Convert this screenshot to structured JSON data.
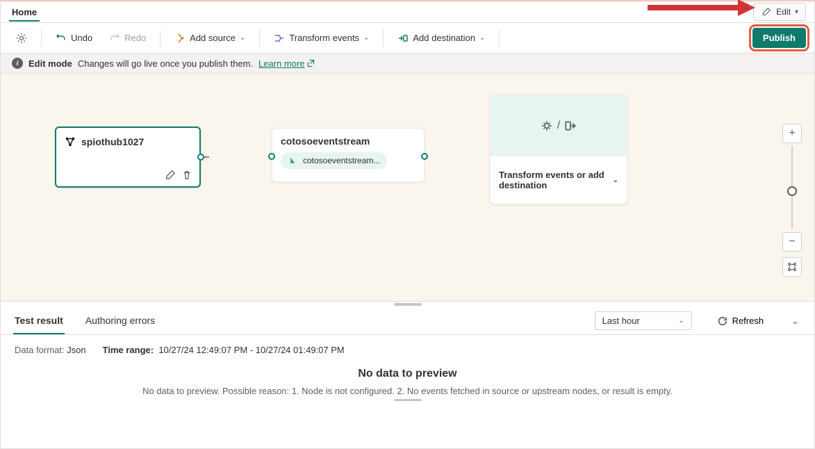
{
  "ribbon": {
    "home_tab": "Home",
    "edit_label": "Edit"
  },
  "toolbar": {
    "undo": "Undo",
    "redo": "Redo",
    "add_source": "Add source",
    "transform_events": "Transform events",
    "add_destination": "Add destination",
    "publish": "Publish"
  },
  "info": {
    "mode_label": "Edit mode",
    "message": "Changes will go live once you publish them.",
    "learn_more": "Learn more"
  },
  "nodes": {
    "source": {
      "title": "spiothub1027"
    },
    "stream": {
      "title": "cotosoeventstream",
      "chip": "cotosoeventstream..."
    },
    "destination": {
      "hint": "Transform events or add destination"
    }
  },
  "panel": {
    "tabs": {
      "test_result": "Test result",
      "authoring_errors": "Authoring errors"
    },
    "time_select": "Last hour",
    "refresh": "Refresh",
    "meta": {
      "data_format_label": "Data format:",
      "data_format_value": "Json",
      "time_range_label": "Time range:",
      "time_range_value": "10/27/24 12:49:07 PM - 10/27/24 01:49:07 PM"
    },
    "no_data_title": "No data to preview",
    "no_data_msg": "No data to preview. Possible reason: 1. Node is not configured. 2. No events fetched in source or upstream nodes, or result is empty."
  }
}
